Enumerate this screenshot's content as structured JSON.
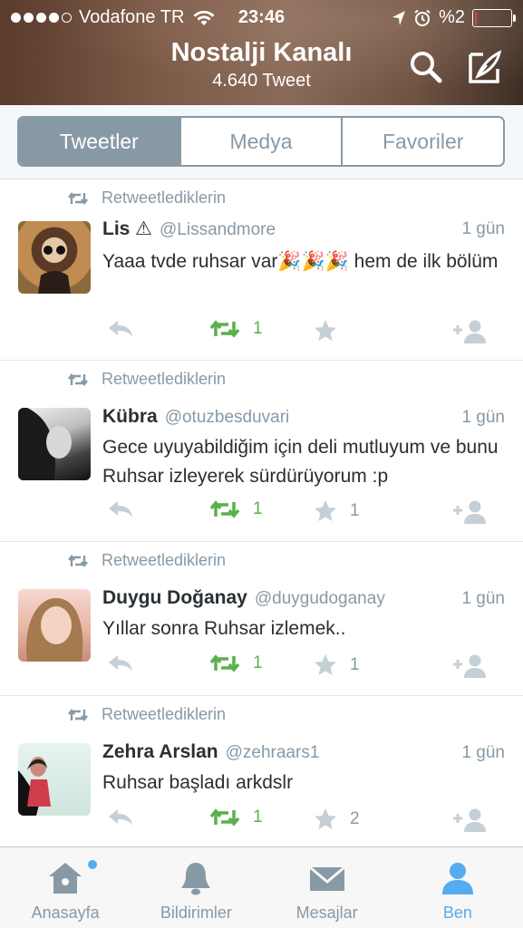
{
  "status_bar": {
    "carrier": "Vodafone TR",
    "time": "23:46",
    "battery": "%2"
  },
  "header": {
    "title": "Nostalji Kanalı",
    "subtitle": "4.640 Tweet"
  },
  "segments": [
    {
      "label": "Tweetler",
      "active": true
    },
    {
      "label": "Medya",
      "active": false
    },
    {
      "label": "Favoriler",
      "active": false
    }
  ],
  "tweets": [
    {
      "retweet_label": "Retweetlediklerin",
      "name": "Lis ⚠",
      "handle": "@Lissandmore",
      "time": "1 gün",
      "text": "Yaaa tvde ruhsar var🎉🎉🎉 hem de ilk bölüm",
      "retweets": "1",
      "favorites": ""
    },
    {
      "retweet_label": "Retweetlediklerin",
      "name": "Kübra",
      "handle": "@otuzbesduvari",
      "time": "1 gün",
      "text": "Gece uyuyabildiğim için deli mutluyum ve bunu Ruhsar izleyerek sürdürüyorum :p",
      "retweets": "1",
      "favorites": "1"
    },
    {
      "retweet_label": "Retweetlediklerin",
      "name": "Duygu Doğanay",
      "handle": "@duygudoganay",
      "time": "1 gün",
      "text": "Yıllar sonra Ruhsar izlemek..",
      "retweets": "1",
      "favorites": "1"
    },
    {
      "retweet_label": "Retweetlediklerin",
      "name": "Zehra Arslan",
      "handle": "@zehraars1",
      "time": "1 gün",
      "text": "Ruhsar başladı arkdslr",
      "retweets": "1",
      "favorites": "2"
    }
  ],
  "tabbar": [
    {
      "label": "Anasayfa",
      "icon": "home-icon",
      "active": false,
      "badge": true
    },
    {
      "label": "Bildirimler",
      "icon": "bell-icon",
      "active": false,
      "badge": false
    },
    {
      "label": "Mesajlar",
      "icon": "envelope-icon",
      "active": false,
      "badge": false
    },
    {
      "label": "Ben",
      "icon": "person-icon",
      "active": true,
      "badge": false
    }
  ],
  "colors": {
    "accent": "#55acee",
    "retweet_green": "#5bb04b",
    "muted": "#8899a6"
  }
}
